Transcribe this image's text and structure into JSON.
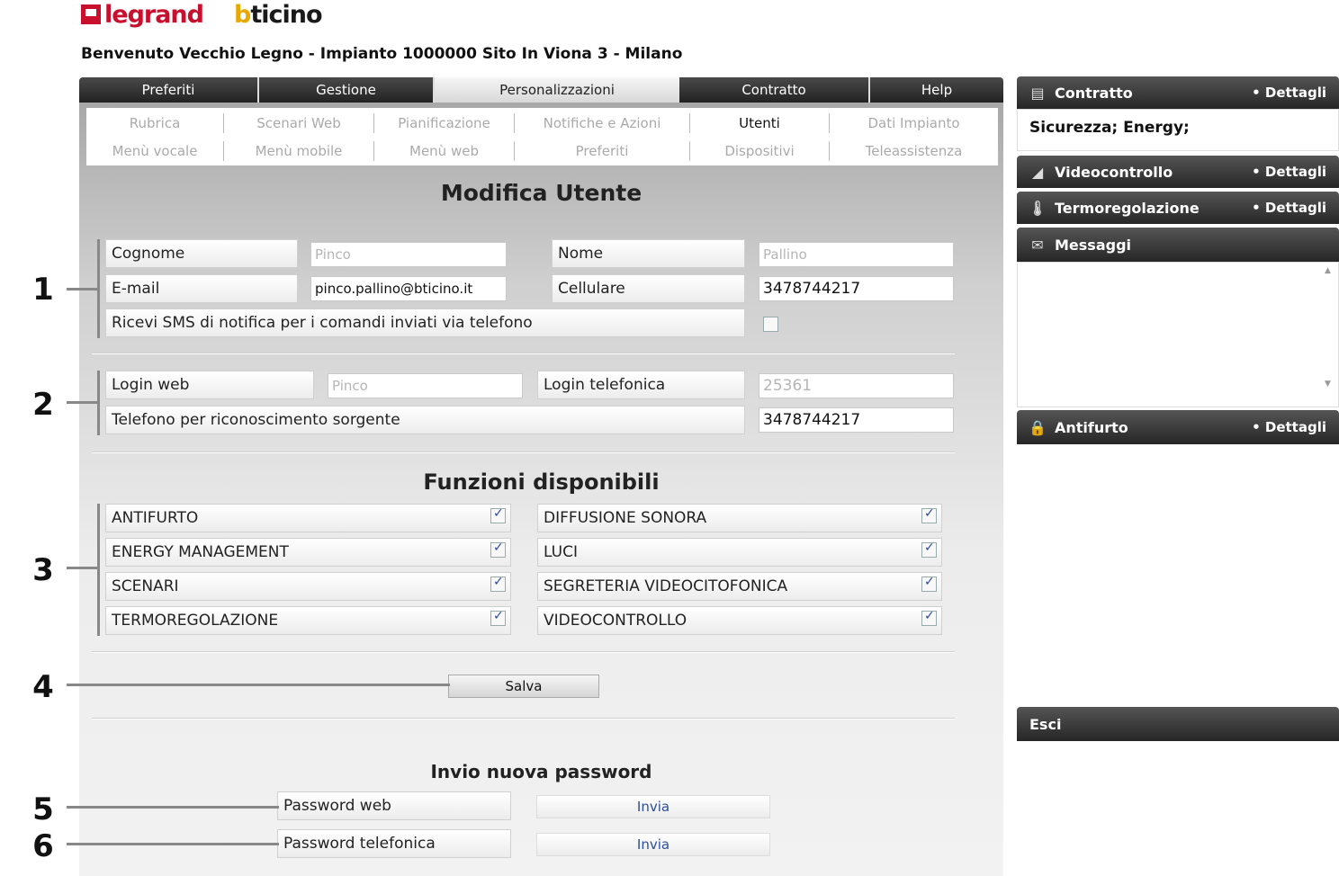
{
  "logos": {
    "legrand": "legrand",
    "bticino_b": "b",
    "bticino_rest": "ticino"
  },
  "welcome": "Benvenuto Vecchio Legno - Impianto 1000000 Sito In Viona 3 - Milano",
  "tabs": [
    "Preferiti",
    "Gestione",
    "Personalizzazioni",
    "Contratto",
    "Help"
  ],
  "subnav": {
    "row1": [
      "Rubrica",
      "Scenari Web",
      "Pianificazione",
      "Notifiche e Azioni",
      "Utenti",
      "Dati Impianto"
    ],
    "row2": [
      "Menù vocale",
      "Menù mobile",
      "Menù web",
      "Preferiti",
      "Dispositivi",
      "Teleassistenza"
    ]
  },
  "title": "Modifica Utente",
  "user": {
    "cognome_label": "Cognome",
    "cognome_placeholder": "Pinco",
    "nome_label": "Nome",
    "nome_placeholder": "Pallino",
    "email_label": "E-mail",
    "email_value": "pinco.pallino@bticino.it",
    "cellulare_label": "Cellulare",
    "cellulare_value": "3478744217",
    "sms_label": "Ricevi SMS di notifica per i comandi inviati via telefono",
    "sms_checked": false
  },
  "login": {
    "web_label": "Login web",
    "web_placeholder": "Pinco",
    "tel_label": "Login telefonica",
    "tel_value": "25361",
    "phone_src_label": "Telefono per riconoscimento sorgente",
    "phone_src_value": "3478744217"
  },
  "functions_title": "Funzioni disponibili",
  "functions_left": [
    "ANTIFURTO",
    "ENERGY MANAGEMENT",
    "SCENARI",
    "TERMOREGOLAZIONE"
  ],
  "functions_right": [
    "DIFFUSIONE SONORA",
    "LUCI",
    "SEGRETERIA VIDEOCITOFONICA",
    "VIDEOCONTROLLO"
  ],
  "save_label": "Salva",
  "password": {
    "title": "Invio nuova password",
    "web_label": "Password web",
    "tel_label": "Password telefonica",
    "send_label": "Invia"
  },
  "callouts": [
    "1",
    "2",
    "3",
    "4",
    "5",
    "6"
  ],
  "sidebar": {
    "contratto": "Contratto",
    "contratto_body": "Sicurezza; Energy;",
    "videocontrollo": "Videocontrollo",
    "termoregolazione": "Termoregolazione",
    "messaggi": "Messaggi",
    "antifurto": "Antifurto",
    "dettagli": "• Dettagli",
    "esci": "Esci"
  }
}
